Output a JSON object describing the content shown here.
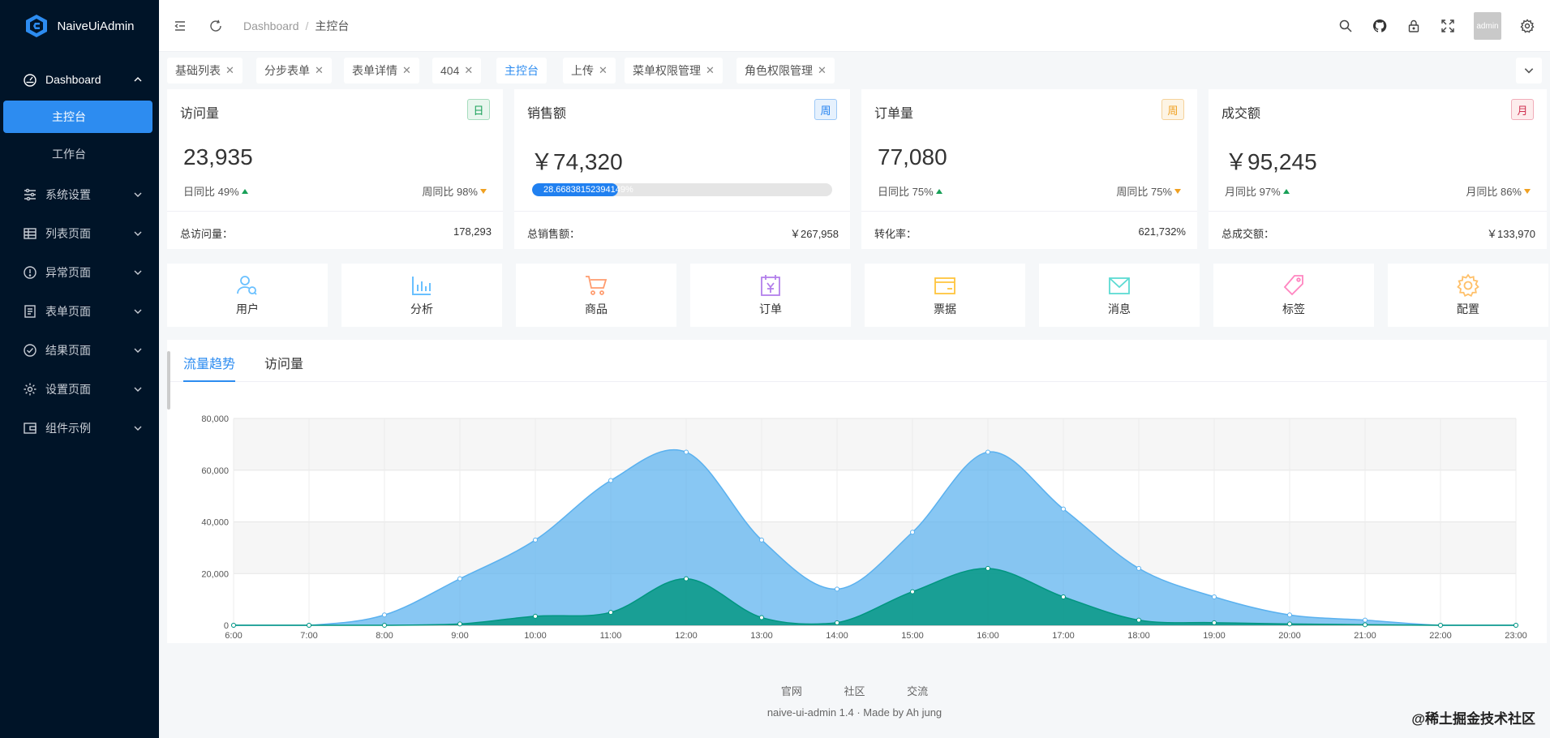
{
  "app": {
    "name": "NaiveUiAdmin"
  },
  "sidebar": {
    "items": [
      {
        "label": "Dashboard",
        "icon": "dashboard-icon",
        "open": true,
        "children": [
          {
            "label": "主控台",
            "active": true
          },
          {
            "label": "工作台",
            "active": false
          }
        ]
      },
      {
        "label": "系统设置",
        "icon": "settings-sliders-icon"
      },
      {
        "label": "列表页面",
        "icon": "table-icon"
      },
      {
        "label": "异常页面",
        "icon": "alert-circle-icon"
      },
      {
        "label": "表单页面",
        "icon": "form-icon"
      },
      {
        "label": "结果页面",
        "icon": "check-circle-icon"
      },
      {
        "label": "设置页面",
        "icon": "gear-icon"
      },
      {
        "label": "组件示例",
        "icon": "wallet-icon"
      }
    ]
  },
  "header": {
    "breadcrumb": [
      "Dashboard",
      "主控台"
    ],
    "avatar_text": "admin"
  },
  "tabs": [
    {
      "label": "基础列表",
      "closable": true
    },
    {
      "label": "分步表单",
      "closable": true
    },
    {
      "label": "表单详情",
      "closable": true
    },
    {
      "label": "404",
      "closable": true
    },
    {
      "label": "主控台",
      "closable": false,
      "active": true
    },
    {
      "label": "上传",
      "closable": true
    },
    {
      "label": "菜单权限管理",
      "closable": true
    },
    {
      "label": "角色权限管理",
      "closable": true
    }
  ],
  "stats": [
    {
      "title": "访问量",
      "badge": "日",
      "value": "23,935",
      "left_label": "日同比 49%",
      "right_label": "周同比 98%",
      "foot_label": "总访问量：",
      "foot_value": "178,293"
    },
    {
      "title": "销售额",
      "badge": "周",
      "value": "￥74,320",
      "progress_text": "28.66838152394149%",
      "progress": 0.2867,
      "foot_label": "总销售额：",
      "foot_value": "￥267,958"
    },
    {
      "title": "订单量",
      "badge": "周",
      "value": "77,080",
      "left_label": "日同比 75%",
      "right_label": "周同比 75%",
      "foot_label": "转化率：",
      "foot_value": "621,732%"
    },
    {
      "title": "成交额",
      "badge": "月",
      "value": "￥95,245",
      "left_label": "月同比 97%",
      "right_label": "月同比 86%",
      "foot_label": "总成交额：",
      "foot_value": "￥133,970"
    }
  ],
  "quick_nav": [
    {
      "label": "用户",
      "icon": "user-add-icon",
      "color": "#69c0ff"
    },
    {
      "label": "分析",
      "icon": "bar-chart-icon",
      "color": "#69c0ff"
    },
    {
      "label": "商品",
      "icon": "cart-icon",
      "color": "#ff9c6e"
    },
    {
      "label": "订单",
      "icon": "calendar-order-icon",
      "color": "#b37feb"
    },
    {
      "label": "票据",
      "icon": "credit-card-icon",
      "color": "#ffd666"
    },
    {
      "label": "消息",
      "icon": "mail-icon",
      "color": "#5cdbd3"
    },
    {
      "label": "标签",
      "icon": "tag-icon",
      "color": "#ff85c0"
    },
    {
      "label": "配置",
      "icon": "gear-icon",
      "color": "#ffc069"
    }
  ],
  "chart_tabs": [
    "流量趋势",
    "访问量"
  ],
  "chart_data": {
    "type": "area",
    "x": [
      "6:00",
      "7:00",
      "8:00",
      "9:00",
      "10:00",
      "11:00",
      "12:00",
      "13:00",
      "14:00",
      "15:00",
      "16:00",
      "17:00",
      "18:00",
      "19:00",
      "20:00",
      "21:00",
      "22:00",
      "23:00"
    ],
    "series": [
      {
        "values": [
          0,
          0,
          4000,
          18000,
          33000,
          56000,
          67000,
          33000,
          14000,
          36000,
          67000,
          45000,
          22000,
          11000,
          4000,
          2000,
          0,
          0
        ],
        "color": "#5ab1ef"
      },
      {
        "values": [
          0,
          0,
          0,
          500,
          3500,
          5000,
          18000,
          3000,
          1000,
          13000,
          22000,
          11000,
          2000,
          1000,
          500,
          200,
          0,
          0
        ],
        "color": "#019680"
      }
    ],
    "ylim": [
      0,
      80000
    ],
    "yticks": [
      "0",
      "20,000",
      "40,000",
      "60,000",
      "80,000"
    ],
    "grid": true
  },
  "footer": {
    "links": [
      "官网",
      "社区",
      "交流"
    ],
    "copyright": "naive-ui-admin 1.4 · Made by Ah jung",
    "watermark": "@稀土掘金技术社区"
  }
}
